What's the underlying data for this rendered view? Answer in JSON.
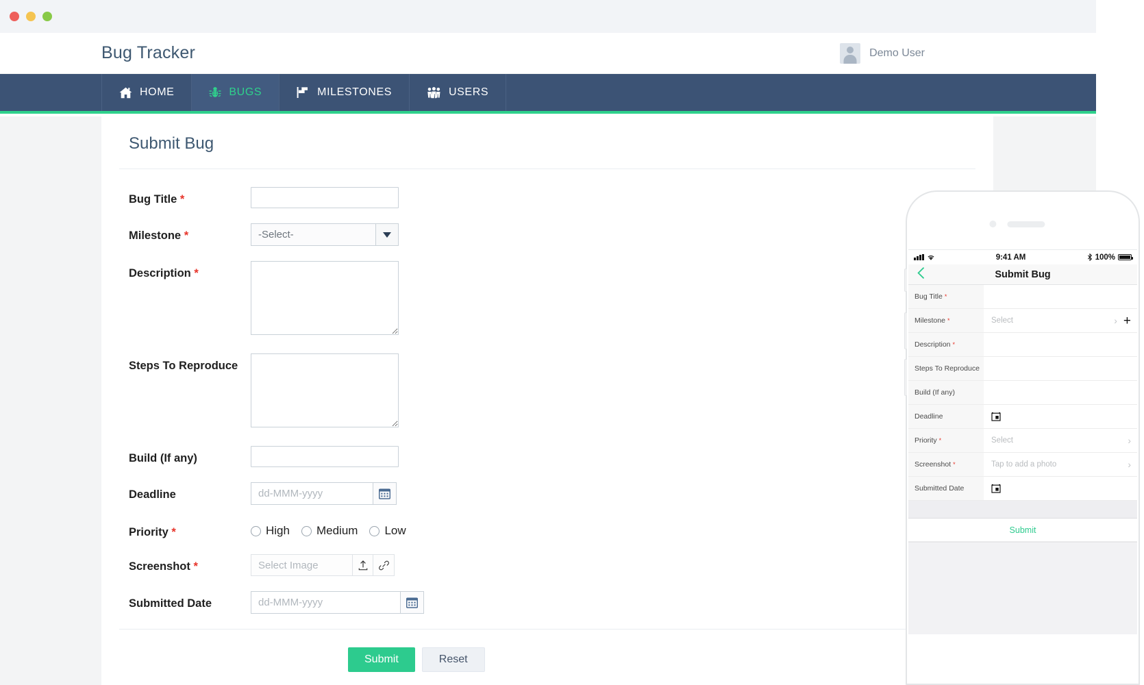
{
  "browser": {
    "traffic_lights": [
      "close",
      "minimize",
      "maximize"
    ]
  },
  "app": {
    "brand": "Bug Tracker",
    "user": {
      "name": "Demo User"
    },
    "nav": [
      {
        "label": "HOME",
        "icon": "home-icon",
        "active": false
      },
      {
        "label": "BUGS",
        "icon": "bug-icon",
        "active": true
      },
      {
        "label": "MILESTONES",
        "icon": "flag-icon",
        "active": false
      },
      {
        "label": "USERS",
        "icon": "users-icon",
        "active": false
      }
    ],
    "accent_color": "#2fd18c",
    "navbar_color": "#3c5375"
  },
  "form": {
    "title": "Submit Bug",
    "fields": {
      "bug_title": {
        "label": "Bug Title",
        "required": true,
        "value": ""
      },
      "milestone": {
        "label": "Milestone",
        "required": true,
        "value": "-Select-"
      },
      "description": {
        "label": "Description",
        "required": true,
        "value": ""
      },
      "steps": {
        "label": "Steps To Reproduce",
        "required": false,
        "value": ""
      },
      "build": {
        "label": "Build (If any)",
        "required": false,
        "value": ""
      },
      "deadline": {
        "label": "Deadline",
        "required": false,
        "placeholder": "dd-MMM-yyyy",
        "value": ""
      },
      "priority": {
        "label": "Priority",
        "required": true,
        "options": [
          "High",
          "Medium",
          "Low"
        ],
        "selected": ""
      },
      "screenshot": {
        "label": "Screenshot",
        "required": true,
        "placeholder": "Select Image",
        "value": ""
      },
      "submitted_date": {
        "label": "Submitted Date",
        "required": false,
        "placeholder": "dd-MMM-yyyy",
        "value": ""
      }
    },
    "buttons": {
      "submit": "Submit",
      "reset": "Reset"
    }
  },
  "phone": {
    "status": {
      "time": "9:41 AM",
      "battery_percent": "100%",
      "signal": "signal-bars-icon",
      "wifi": "wifi-icon",
      "bluetooth": "bluetooth-icon"
    },
    "navbar": {
      "back": "back-chevron-icon",
      "title": "Submit Bug"
    },
    "rows": [
      {
        "label": "Bug Title",
        "required": true,
        "value": "",
        "accessory": ""
      },
      {
        "label": "Milestone",
        "required": true,
        "value": "Select",
        "accessory": "chevron-plus"
      },
      {
        "label": "Description",
        "required": true,
        "value": "",
        "accessory": ""
      },
      {
        "label": "Steps To Reproduce",
        "required": false,
        "value": "",
        "accessory": ""
      },
      {
        "label": "Build (If any)",
        "required": false,
        "value": "",
        "accessory": ""
      },
      {
        "label": "Deadline",
        "required": false,
        "value": "",
        "accessory": "calendar"
      },
      {
        "label": "Priority",
        "required": true,
        "value": "Select",
        "accessory": "chevron"
      },
      {
        "label": "Screenshot",
        "required": true,
        "value": "Tap to add a photo",
        "accessory": "chevron"
      },
      {
        "label": "Submitted Date",
        "required": false,
        "value": "",
        "accessory": "calendar"
      }
    ],
    "submit_label": "Submit"
  }
}
